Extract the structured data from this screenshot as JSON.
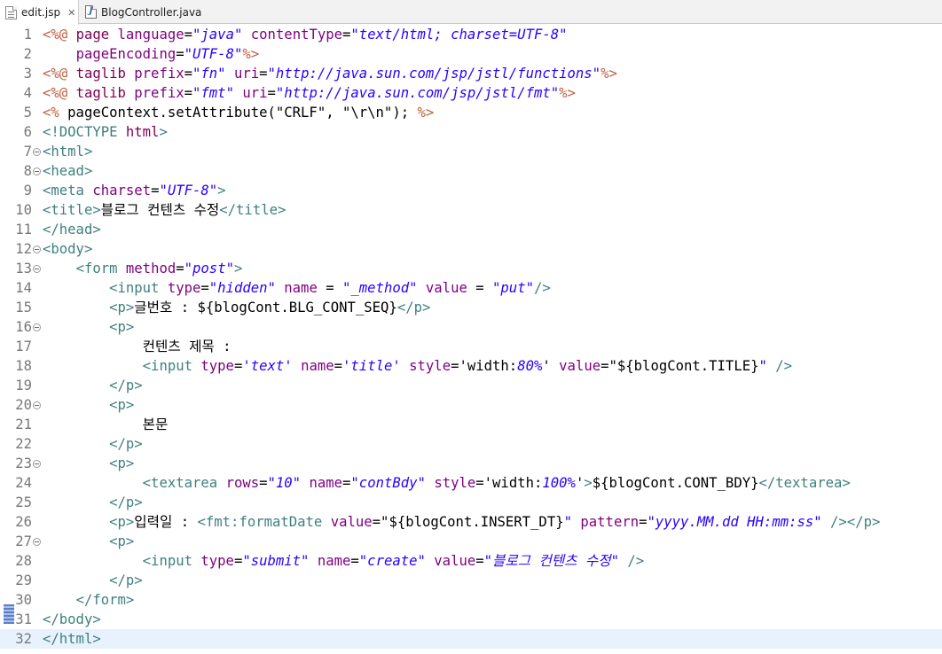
{
  "tabs": [
    {
      "label": "edit.jsp",
      "active": true
    },
    {
      "label": "BlogController.java",
      "active": false
    }
  ],
  "icons": {
    "jsp_file": "jsp-file-icon",
    "java_file": "java-file-icon",
    "close": "close-icon",
    "fold": "fold-toggle-icon"
  },
  "colors": {
    "directive": "#bf5f3f",
    "keyword": "#7f0055",
    "tag": "#3f7f7f",
    "attribute": "#7f007f",
    "value": "#2a00ff",
    "line_number": "#787878",
    "current_line": "#e8f2fe"
  },
  "current_line": 32,
  "lines": [
    {
      "n": "1",
      "fold": false,
      "tokens": [
        [
          "dir",
          "<%@ "
        ],
        [
          "kw",
          "page "
        ],
        [
          "attr",
          "language"
        ],
        [
          "txt",
          "="
        ],
        [
          "val",
          "\"java\""
        ],
        [
          "txt",
          " "
        ],
        [
          "attr",
          "contentType"
        ],
        [
          "txt",
          "="
        ],
        [
          "val",
          "\"text/html; charset=UTF-8\""
        ]
      ]
    },
    {
      "n": "2",
      "fold": false,
      "tokens": [
        [
          "txt",
          "    "
        ],
        [
          "attr",
          "pageEncoding"
        ],
        [
          "txt",
          "="
        ],
        [
          "val",
          "\"UTF-8\""
        ],
        [
          "dir",
          "%>"
        ]
      ]
    },
    {
      "n": "3",
      "fold": false,
      "tokens": [
        [
          "dir",
          "<%@ "
        ],
        [
          "kw",
          "taglib "
        ],
        [
          "attr",
          "prefix"
        ],
        [
          "txt",
          "="
        ],
        [
          "val",
          "\"fn\""
        ],
        [
          "txt",
          " "
        ],
        [
          "attr",
          "uri"
        ],
        [
          "txt",
          "="
        ],
        [
          "val",
          "\"http://java.sun.com/jsp/jstl/functions\""
        ],
        [
          "dir",
          "%>"
        ]
      ]
    },
    {
      "n": "4",
      "fold": false,
      "tokens": [
        [
          "dir",
          "<%@ "
        ],
        [
          "kw",
          "taglib "
        ],
        [
          "attr",
          "prefix"
        ],
        [
          "txt",
          "="
        ],
        [
          "val",
          "\"fmt\""
        ],
        [
          "txt",
          " "
        ],
        [
          "attr",
          "uri"
        ],
        [
          "txt",
          "="
        ],
        [
          "val",
          "\"http://java.sun.com/jsp/jstl/fmt\""
        ],
        [
          "dir",
          "%>"
        ]
      ]
    },
    {
      "n": "5",
      "fold": false,
      "tokens": [
        [
          "dir",
          "<% "
        ],
        [
          "txt",
          "pageContext.setAttribute(\"CRLF\", \"\\r\\n\"); "
        ],
        [
          "dir",
          "%>"
        ]
      ]
    },
    {
      "n": "6",
      "fold": false,
      "tokens": [
        [
          "tag",
          "<!DOCTYPE "
        ],
        [
          "kw",
          "html"
        ],
        [
          "tag",
          ">"
        ]
      ]
    },
    {
      "n": "7",
      "fold": true,
      "tokens": [
        [
          "tag",
          "<html>"
        ]
      ]
    },
    {
      "n": "8",
      "fold": true,
      "tokens": [
        [
          "tag",
          "<head>"
        ]
      ]
    },
    {
      "n": "9",
      "fold": false,
      "tokens": [
        [
          "tag",
          "<meta "
        ],
        [
          "attr",
          "charset"
        ],
        [
          "txt",
          "="
        ],
        [
          "val",
          "\"UTF-8\""
        ],
        [
          "tag",
          ">"
        ]
      ]
    },
    {
      "n": "10",
      "fold": false,
      "tokens": [
        [
          "tag",
          "<title>"
        ],
        [
          "txt",
          "블로그 컨텐츠 수정"
        ],
        [
          "tag",
          "</title>"
        ]
      ]
    },
    {
      "n": "11",
      "fold": false,
      "tokens": [
        [
          "tag",
          "</head>"
        ]
      ]
    },
    {
      "n": "12",
      "fold": true,
      "tokens": [
        [
          "tag",
          "<body>"
        ]
      ]
    },
    {
      "n": "13",
      "fold": true,
      "tokens": [
        [
          "txt",
          "    "
        ],
        [
          "tag",
          "<form "
        ],
        [
          "attr",
          "method"
        ],
        [
          "txt",
          "="
        ],
        [
          "val",
          "\"post\""
        ],
        [
          "tag",
          ">"
        ]
      ]
    },
    {
      "n": "14",
      "fold": false,
      "tokens": [
        [
          "txt",
          "        "
        ],
        [
          "tag",
          "<input "
        ],
        [
          "attr",
          "type"
        ],
        [
          "txt",
          "="
        ],
        [
          "val",
          "\"hidden\""
        ],
        [
          "txt",
          " "
        ],
        [
          "attr",
          "name"
        ],
        [
          "txt",
          " = "
        ],
        [
          "val",
          "\"_method\""
        ],
        [
          "txt",
          " "
        ],
        [
          "attr",
          "value"
        ],
        [
          "txt",
          " = "
        ],
        [
          "val",
          "\"put\""
        ],
        [
          "tag",
          "/>"
        ]
      ]
    },
    {
      "n": "15",
      "fold": false,
      "tokens": [
        [
          "txt",
          "        "
        ],
        [
          "tag",
          "<p>"
        ],
        [
          "txt",
          "글번호 : ${blogCont.BLG_CONT_SEQ}"
        ],
        [
          "tag",
          "</p>"
        ]
      ]
    },
    {
      "n": "16",
      "fold": true,
      "tokens": [
        [
          "txt",
          "        "
        ],
        [
          "tag",
          "<p>"
        ]
      ]
    },
    {
      "n": "17",
      "fold": false,
      "tokens": [
        [
          "txt",
          "            컨텐츠 제목 :"
        ]
      ]
    },
    {
      "n": "18",
      "fold": false,
      "tokens": [
        [
          "txt",
          "            "
        ],
        [
          "tag",
          "<input "
        ],
        [
          "attr",
          "type"
        ],
        [
          "txt",
          "="
        ],
        [
          "val",
          "'text'"
        ],
        [
          "txt",
          " "
        ],
        [
          "attr",
          "name"
        ],
        [
          "txt",
          "="
        ],
        [
          "val",
          "'title'"
        ],
        [
          "txt",
          " "
        ],
        [
          "attr",
          "style"
        ],
        [
          "txt",
          "='width:"
        ],
        [
          "val",
          "80%"
        ],
        [
          "txt",
          "' "
        ],
        [
          "attr",
          "value"
        ],
        [
          "txt",
          "=\"${blogCont.TITLE}"
        ],
        [
          "val",
          "\""
        ],
        [
          "txt",
          " "
        ],
        [
          "tag",
          "/>"
        ]
      ]
    },
    {
      "n": "19",
      "fold": false,
      "tokens": [
        [
          "txt",
          "        "
        ],
        [
          "tag",
          "</p>"
        ]
      ]
    },
    {
      "n": "20",
      "fold": true,
      "tokens": [
        [
          "txt",
          "        "
        ],
        [
          "tag",
          "<p>"
        ]
      ]
    },
    {
      "n": "21",
      "fold": false,
      "tokens": [
        [
          "txt",
          "            본문"
        ]
      ]
    },
    {
      "n": "22",
      "fold": false,
      "tokens": [
        [
          "txt",
          "        "
        ],
        [
          "tag",
          "</p>"
        ]
      ]
    },
    {
      "n": "23",
      "fold": true,
      "tokens": [
        [
          "txt",
          "        "
        ],
        [
          "tag",
          "<p>"
        ]
      ]
    },
    {
      "n": "24",
      "fold": false,
      "tokens": [
        [
          "txt",
          "            "
        ],
        [
          "tag",
          "<textarea "
        ],
        [
          "attr",
          "rows"
        ],
        [
          "txt",
          "="
        ],
        [
          "val",
          "\"10\""
        ],
        [
          "txt",
          " "
        ],
        [
          "attr",
          "name"
        ],
        [
          "txt",
          "="
        ],
        [
          "val",
          "\"contBdy\""
        ],
        [
          "txt",
          " "
        ],
        [
          "attr",
          "style"
        ],
        [
          "txt",
          "='width:"
        ],
        [
          "val",
          "100%"
        ],
        [
          "txt",
          "'"
        ],
        [
          "tag",
          ">"
        ],
        [
          "txt",
          "${blogCont.CONT_BDY}"
        ],
        [
          "tag",
          "</textarea>"
        ]
      ]
    },
    {
      "n": "25",
      "fold": false,
      "tokens": [
        [
          "txt",
          "        "
        ],
        [
          "tag",
          "</p>"
        ]
      ]
    },
    {
      "n": "26",
      "fold": false,
      "tokens": [
        [
          "txt",
          "        "
        ],
        [
          "tag",
          "<p>"
        ],
        [
          "txt",
          "입력일 : "
        ],
        [
          "tag",
          "<fmt:formatDate "
        ],
        [
          "attr",
          "value"
        ],
        [
          "txt",
          "=\"${blogCont.INSERT_DT}"
        ],
        [
          "val",
          "\""
        ],
        [
          "txt",
          " "
        ],
        [
          "attr",
          "pattern"
        ],
        [
          "txt",
          "="
        ],
        [
          "val",
          "\"yyyy.MM.dd HH:mm:ss\""
        ],
        [
          "txt",
          " "
        ],
        [
          "tag",
          "/></p>"
        ]
      ]
    },
    {
      "n": "27",
      "fold": true,
      "tokens": [
        [
          "txt",
          "        "
        ],
        [
          "tag",
          "<p>"
        ]
      ]
    },
    {
      "n": "28",
      "fold": false,
      "tokens": [
        [
          "txt",
          "            "
        ],
        [
          "tag",
          "<input "
        ],
        [
          "attr",
          "type"
        ],
        [
          "txt",
          "="
        ],
        [
          "val",
          "\"submit\""
        ],
        [
          "txt",
          " "
        ],
        [
          "attr",
          "name"
        ],
        [
          "txt",
          "="
        ],
        [
          "val",
          "\"create\""
        ],
        [
          "txt",
          " "
        ],
        [
          "attr",
          "value"
        ],
        [
          "txt",
          "="
        ],
        [
          "val",
          "\"블로그 컨텐츠 수정\""
        ],
        [
          "txt",
          " "
        ],
        [
          "tag",
          "/>"
        ]
      ]
    },
    {
      "n": "29",
      "fold": false,
      "tokens": [
        [
          "txt",
          "        "
        ],
        [
          "tag",
          "</p>"
        ]
      ]
    },
    {
      "n": "30",
      "fold": false,
      "tokens": [
        [
          "txt",
          "    "
        ],
        [
          "tag",
          "</form>"
        ]
      ]
    },
    {
      "n": "31",
      "fold": false,
      "tokens": [
        [
          "tag",
          "</body>"
        ]
      ]
    },
    {
      "n": "32",
      "fold": false,
      "tokens": [
        [
          "tag",
          "</html>"
        ]
      ]
    }
  ]
}
